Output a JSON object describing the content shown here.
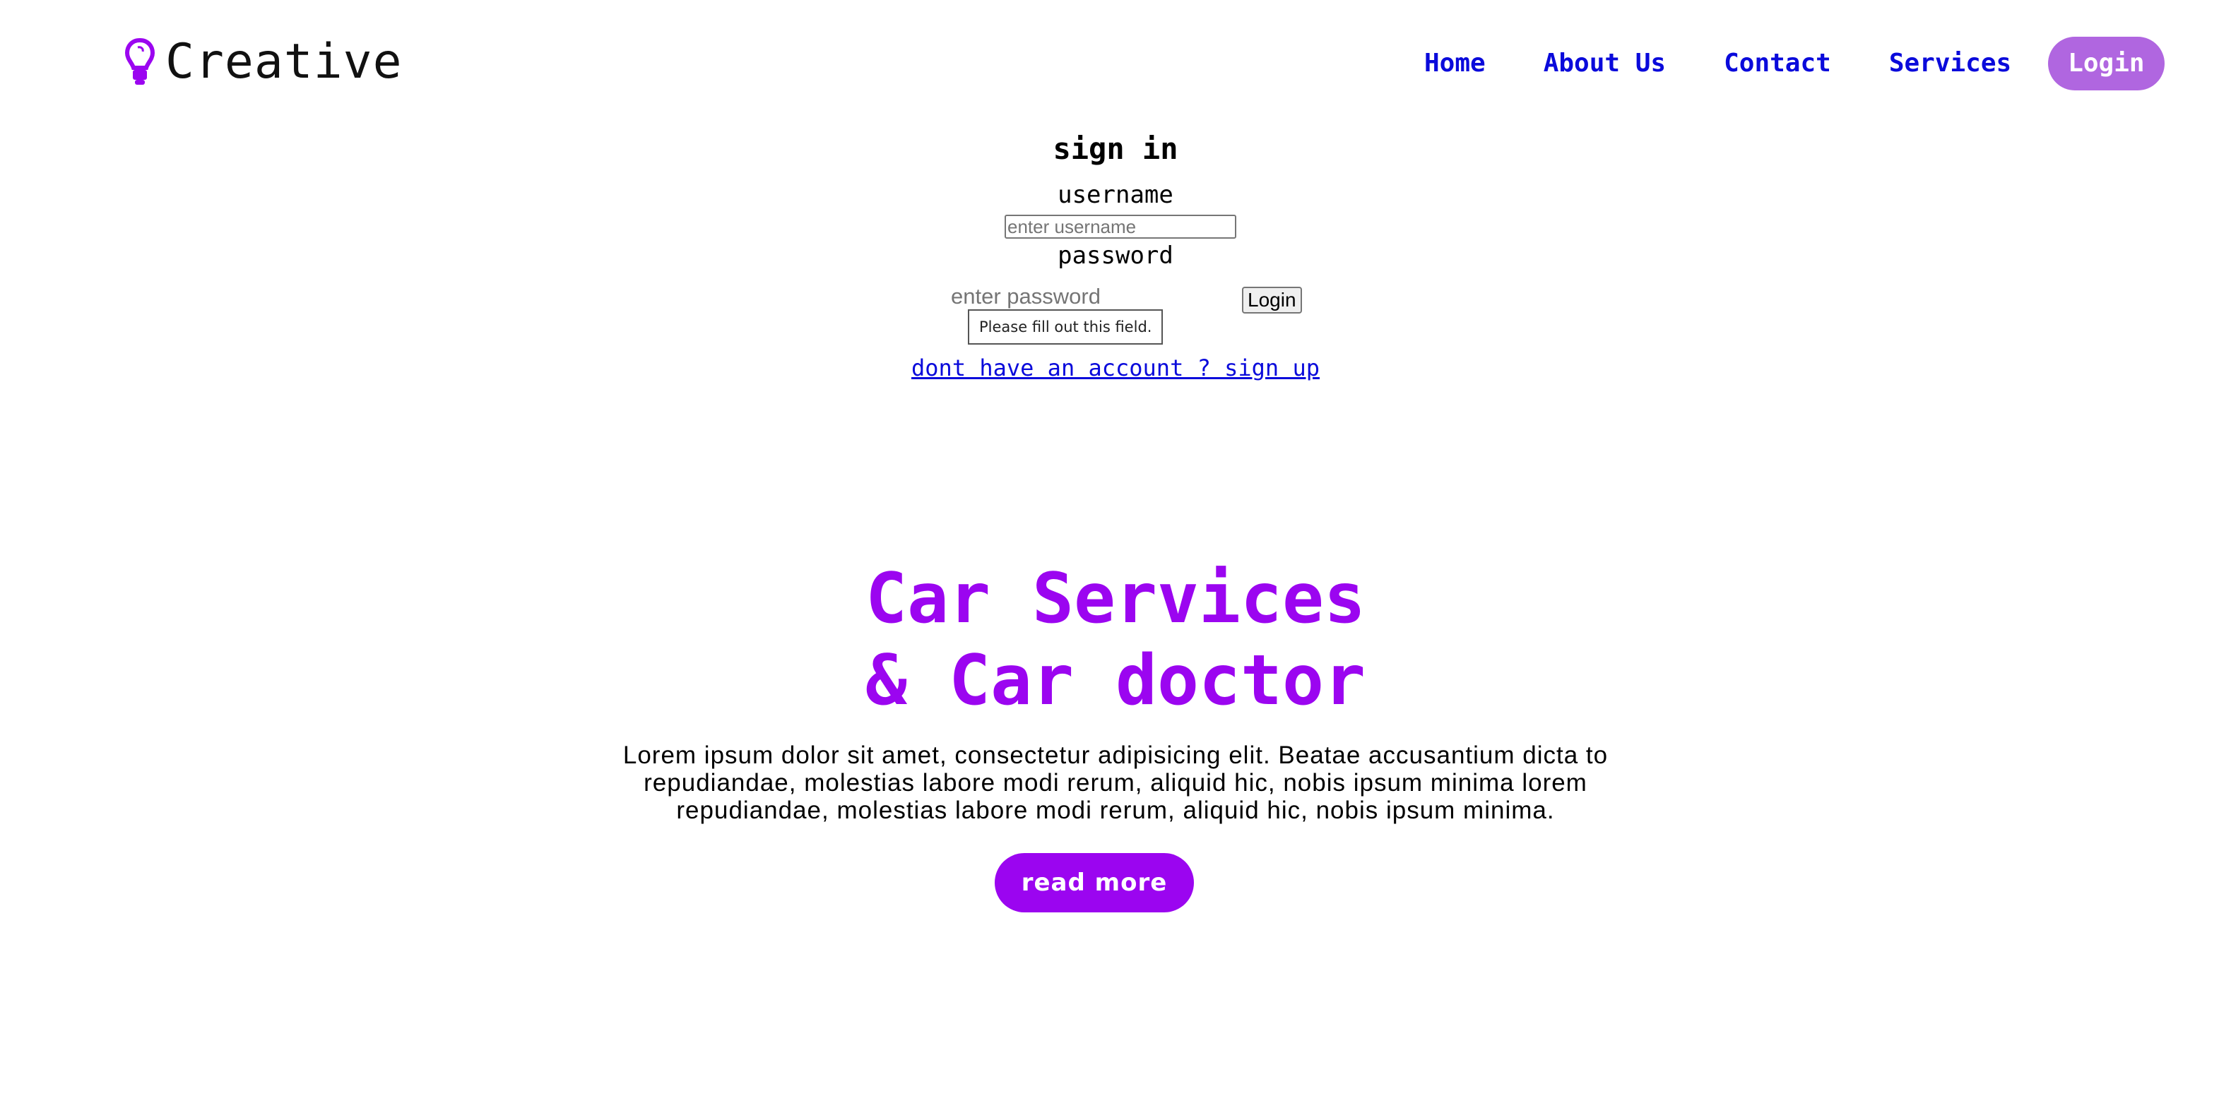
{
  "header": {
    "logo_text": "Creative",
    "logo_icon": "lightbulb-icon",
    "nav": [
      "Home",
      "About Us",
      "Contact",
      "Services"
    ],
    "login_label": "Login"
  },
  "signin": {
    "title": "sign in",
    "username_label": "username",
    "username_placeholder": "enter username",
    "password_label": "password",
    "password_placeholder": "enter password",
    "submit_label": "Login",
    "validation_tooltip": "Please fill out this field.",
    "signup_link": "dont have an account ? sign up"
  },
  "hero": {
    "title_line1": "Car Services",
    "title_line2": "& Car doctor",
    "text_line1": "Lorem ipsum dolor sit amet, consectetur adipisicing elit. Beatae accusantium dicta to",
    "text_line2": "repudiandae, molestias labore modi rerum, aliquid hic, nobis ipsum minima lorem",
    "text_line3": "repudiandae, molestias labore modi rerum, aliquid hic, nobis ipsum minima.",
    "button_label": "read more"
  },
  "colors": {
    "accent_purple": "#9b05f0",
    "nav_blue": "#0a0adb",
    "login_pill": "#b066e0"
  }
}
